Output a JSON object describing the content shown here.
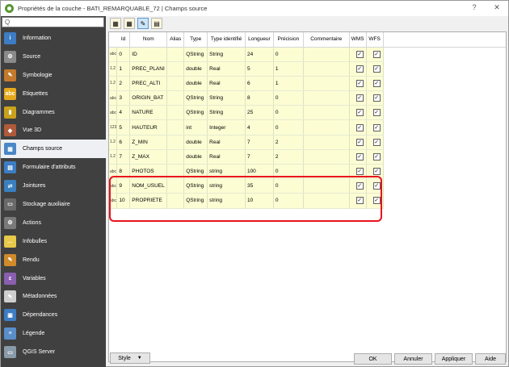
{
  "window": {
    "title": "Propriétés de la couche - BATI_REMARQUABLE_72 | Champs source",
    "help_glyph": "?",
    "close_glyph": "✕"
  },
  "sidebar": {
    "search_glyph": "Q",
    "items": [
      {
        "label": "Information",
        "icon": "info-icon",
        "color": "#3c7dc4",
        "glyph": "i"
      },
      {
        "label": "Source",
        "icon": "source-gears-icon",
        "color": "#8a8a8a",
        "glyph": "⚙"
      },
      {
        "label": "Symbologie",
        "icon": "symbology-brush-icon",
        "color": "#c47a2c",
        "glyph": "✎"
      },
      {
        "label": "Etiquettes",
        "icon": "labels-abc-icon",
        "color": "#e6a81b",
        "glyph": "abc"
      },
      {
        "label": "Diagrammes",
        "icon": "diagrams-icon",
        "color": "#c9a21c",
        "glyph": "▮"
      },
      {
        "label": "Vue 3D",
        "icon": "cube-3d-icon",
        "color": "#b05a3a",
        "glyph": "◆"
      },
      {
        "label": "Champs source",
        "icon": "source-fields-icon",
        "color": "#4a87c7",
        "glyph": "▦"
      },
      {
        "label": "Formulaire d'attributs",
        "icon": "attributes-form-icon",
        "color": "#3c7dc4",
        "glyph": "▤"
      },
      {
        "label": "Jointures",
        "icon": "joins-icon",
        "color": "#3a7fbf",
        "glyph": "⇄"
      },
      {
        "label": "Stockage auxiliaire",
        "icon": "auxiliary-storage-icon",
        "color": "#6a6a6a",
        "glyph": "▭"
      },
      {
        "label": "Actions",
        "icon": "actions-gear-icon",
        "color": "#7a7a7a",
        "glyph": "⚙"
      },
      {
        "label": "Infobulles",
        "icon": "tooltip-bubble-icon",
        "color": "#e8c94a",
        "glyph": "…"
      },
      {
        "label": "Rendu",
        "icon": "rendering-brush-icon",
        "color": "#d08a2a",
        "glyph": "✎"
      },
      {
        "label": "Variables",
        "icon": "variables-icon",
        "color": "#8a5fb0",
        "glyph": "ε"
      },
      {
        "label": "Métadonnées",
        "icon": "metadata-icon",
        "color": "#cfcfcf",
        "glyph": "✎"
      },
      {
        "label": "Dépendances",
        "icon": "dependencies-icon",
        "color": "#3c7dc4",
        "glyph": "▣"
      },
      {
        "label": "Légende",
        "icon": "legend-icon",
        "color": "#5a8ec9",
        "glyph": "≡"
      },
      {
        "label": "QGIS Server",
        "icon": "qgis-server-icon",
        "color": "#8a9aa8",
        "glyph": "▭"
      }
    ],
    "selected_index": 6
  },
  "toolbar": {
    "buttons": [
      {
        "icon": "new-field-icon",
        "glyph": "▦"
      },
      {
        "icon": "delete-field-icon",
        "glyph": "▦"
      },
      {
        "icon": "toggle-editing-pencil-icon",
        "glyph": "✎"
      },
      {
        "icon": "field-calculator-icon",
        "glyph": "▤"
      }
    ]
  },
  "table": {
    "headers": [
      "Id",
      "Nom",
      "Alias",
      "Type",
      "Type identifié",
      "Longueur",
      "Précision",
      "Commentaire",
      "WMS",
      "WFS"
    ],
    "rows": [
      {
        "icon": "abc",
        "id": "0",
        "nom": "ID",
        "alias": "",
        "type": "QString",
        "type_id": "String",
        "longueur": "24",
        "precision": "0",
        "commentaire": "",
        "wms": true,
        "wfs": true
      },
      {
        "icon": "1.2",
        "id": "1",
        "nom": "PREC_PLANI",
        "alias": "",
        "type": "double",
        "type_id": "Real",
        "longueur": "5",
        "precision": "1",
        "commentaire": "",
        "wms": true,
        "wfs": true
      },
      {
        "icon": "1.2",
        "id": "2",
        "nom": "PREC_ALTI",
        "alias": "",
        "type": "double",
        "type_id": "Real",
        "longueur": "6",
        "precision": "1",
        "commentaire": "",
        "wms": true,
        "wfs": true
      },
      {
        "icon": "abc",
        "id": "3",
        "nom": "ORIGIN_BAT",
        "alias": "",
        "type": "QString",
        "type_id": "String",
        "longueur": "8",
        "precision": "0",
        "commentaire": "",
        "wms": true,
        "wfs": true
      },
      {
        "icon": "abc",
        "id": "4",
        "nom": "NATURE",
        "alias": "",
        "type": "QString",
        "type_id": "String",
        "longueur": "25",
        "precision": "0",
        "commentaire": "",
        "wms": true,
        "wfs": true
      },
      {
        "icon": "123",
        "id": "5",
        "nom": "HAUTEUR",
        "alias": "",
        "type": "int",
        "type_id": "Integer",
        "longueur": "4",
        "precision": "0",
        "commentaire": "",
        "wms": true,
        "wfs": true
      },
      {
        "icon": "1.2",
        "id": "6",
        "nom": "Z_MIN",
        "alias": "",
        "type": "double",
        "type_id": "Real",
        "longueur": "7",
        "precision": "2",
        "commentaire": "",
        "wms": true,
        "wfs": true
      },
      {
        "icon": "1.2",
        "id": "7",
        "nom": "Z_MAX",
        "alias": "",
        "type": "double",
        "type_id": "Real",
        "longueur": "7",
        "precision": "2",
        "commentaire": "",
        "wms": true,
        "wfs": true
      },
      {
        "icon": "abc",
        "id": "8",
        "nom": "PHOTOS",
        "alias": "",
        "type": "QString",
        "type_id": "string",
        "longueur": "100",
        "precision": "0",
        "commentaire": "",
        "wms": true,
        "wfs": true
      },
      {
        "icon": "abc",
        "id": "9",
        "nom": "NOM_USUEL",
        "alias": "",
        "type": "QString",
        "type_id": "string",
        "longueur": "35",
        "precision": "0",
        "commentaire": "",
        "wms": true,
        "wfs": true
      },
      {
        "icon": "abc",
        "id": "10",
        "nom": "PROPRIETE",
        "alias": "",
        "type": "QString",
        "type_id": "string",
        "longueur": "10",
        "precision": "0",
        "commentaire": "",
        "wms": true,
        "wfs": true
      }
    ],
    "checkmark": "✓",
    "highlight_color": "#e8121d"
  },
  "bottom": {
    "style_label": "Style",
    "style_arrow": "▼",
    "ok_label": "OK",
    "cancel_label": "Annuler",
    "apply_label": "Appliquer",
    "help_label": "Aide"
  }
}
